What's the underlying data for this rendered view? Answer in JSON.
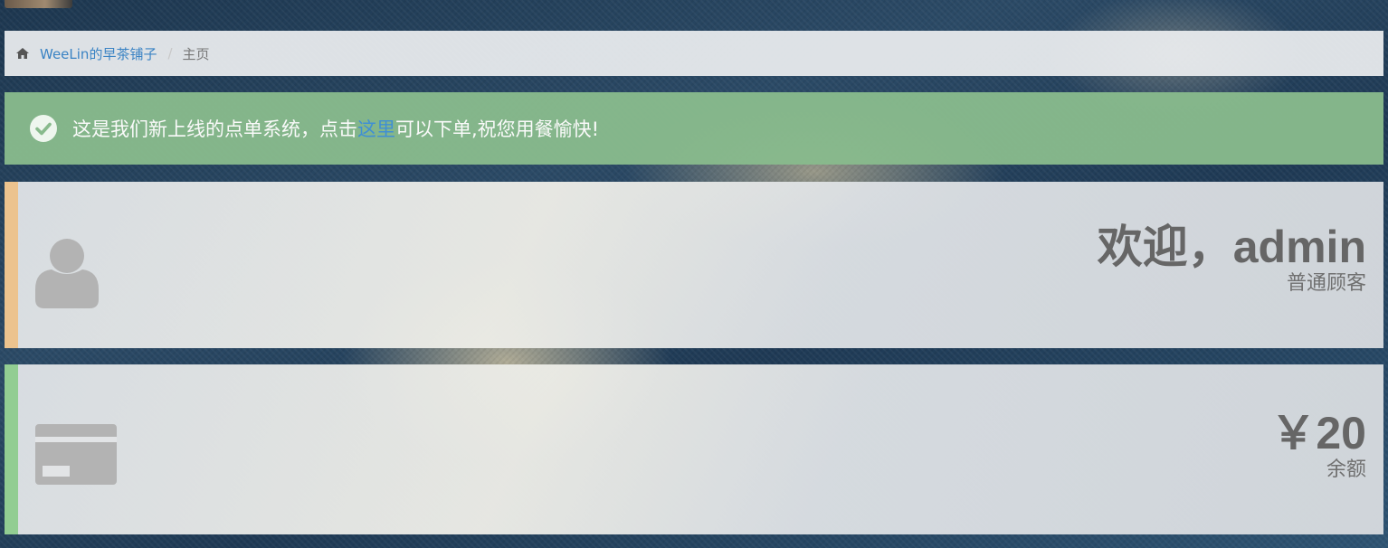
{
  "breadcrumb": {
    "site_name": "WeeLin的早茶铺子",
    "separator": "/",
    "current": "主页",
    "icon": "home-icon"
  },
  "alert": {
    "icon": "check-circle-icon",
    "text_before": "这是我们新上线的点单系统，点击",
    "link_text": "这里",
    "text_after": "可以下单,祝您用餐愉快!",
    "color": "#88ba8c"
  },
  "user_panel": {
    "icon": "user-icon",
    "greeting": "欢迎，admin",
    "role": "普通顾客",
    "accent_color": "#ecc38e"
  },
  "balance_panel": {
    "icon": "credit-card-icon",
    "amount": "￥20",
    "label": "余额",
    "accent_color": "#92cd92"
  }
}
